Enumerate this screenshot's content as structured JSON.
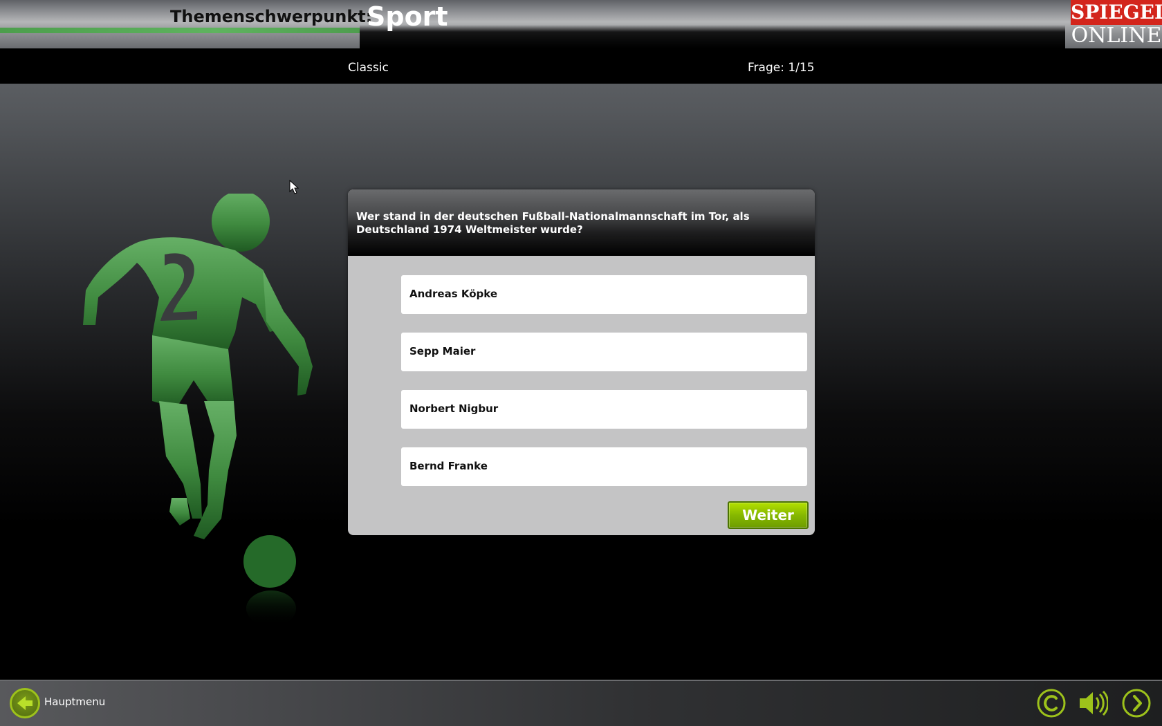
{
  "header": {
    "label": "Themenschwerpunkt:",
    "topic": "Sport",
    "logo_top": "SPIEGEL",
    "logo_bottom": "ONLINE"
  },
  "infobar": {
    "mode": "Classic",
    "counter": "Frage: 1/15"
  },
  "quiz": {
    "question": "Wer stand in der deutschen Fußball-Nationalmannschaft im Tor, als Deutschland 1974 Weltmeister wurde?",
    "answers": [
      {
        "label": "Andreas Köpke"
      },
      {
        "label": "Sepp Maier"
      },
      {
        "label": "Norbert Nigbur"
      },
      {
        "label": "Bernd Franke"
      }
    ],
    "next_label": "Weiter"
  },
  "footer": {
    "menu_label": "Hauptmenu",
    "icons": [
      "back-arrow-icon",
      "copyright-icon",
      "speaker-icon",
      "forward-arrow-icon"
    ]
  },
  "colors": {
    "accent_green": "#86b800",
    "player_green": "#5a9e5a",
    "brand_red": "#d3251c"
  }
}
